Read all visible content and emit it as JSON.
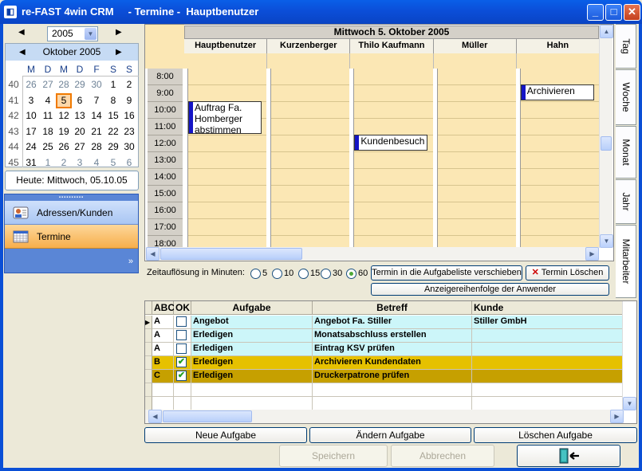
{
  "window": {
    "title": "re-FAST 4win CRM     - Termine -  Hauptbenutzer",
    "icon": "app-logo-icon",
    "controls": {
      "minimize": "_",
      "maximize": "□",
      "close": "✕"
    }
  },
  "year_selector": {
    "year": "2005",
    "prev": "◀",
    "next": "▶"
  },
  "calendar": {
    "month_label": "Oktober 2005",
    "weekdays": [
      "M",
      "D",
      "M",
      "D",
      "F",
      "S",
      "S"
    ],
    "weeks": [
      {
        "kw": "40",
        "days": [
          "26",
          "27",
          "28",
          "29",
          "30",
          "1",
          "2"
        ],
        "other": [
          0,
          1,
          2,
          3,
          4
        ]
      },
      {
        "kw": "41",
        "days": [
          "3",
          "4",
          "5",
          "6",
          "7",
          "8",
          "9"
        ],
        "other": []
      },
      {
        "kw": "42",
        "days": [
          "10",
          "11",
          "12",
          "13",
          "14",
          "15",
          "16"
        ],
        "other": []
      },
      {
        "kw": "43",
        "days": [
          "17",
          "18",
          "19",
          "20",
          "21",
          "22",
          "23"
        ],
        "other": []
      },
      {
        "kw": "44",
        "days": [
          "24",
          "25",
          "26",
          "27",
          "28",
          "29",
          "30"
        ],
        "other": []
      },
      {
        "kw": "45",
        "days": [
          "31",
          "1",
          "2",
          "3",
          "4",
          "5",
          "6"
        ],
        "other": [
          1,
          2,
          3,
          4,
          5,
          6
        ]
      }
    ],
    "selected_day": "5"
  },
  "today_label": "Heute: Mittwoch, 05.10.05",
  "nav": {
    "items": [
      {
        "label": "Adressen/Kunden",
        "icon": "contact-card-icon"
      },
      {
        "label": "Termine",
        "icon": "calendar-grid-icon"
      }
    ],
    "more": "»"
  },
  "scheduler": {
    "date_header": "Mittwoch 5. Oktober 2005",
    "resources": [
      "Hauptbenutzer",
      "Kurzenberger",
      "Thilo Kaufmann",
      "Müller",
      "Hahn"
    ],
    "times": [
      "8:00",
      "9:00",
      "10:00",
      "11:00",
      "12:00",
      "13:00",
      "14:00",
      "15:00",
      "16:00",
      "17:00",
      "18:00"
    ],
    "appointments": [
      {
        "resource": 0,
        "text": "Auftrag Fa. Homberger abstimmen"
      },
      {
        "resource": 4,
        "text": "Archivieren"
      },
      {
        "resource": 2,
        "text": "Kundenbesuch"
      }
    ]
  },
  "view_tabs": [
    "Tag",
    "Woche",
    "Monat",
    "Jahr",
    "Mitarbeiter"
  ],
  "resolution": {
    "label": "Zeitauflösung in Minuten:",
    "options": [
      "5",
      "10",
      "15",
      "30",
      "60"
    ],
    "selected": "60"
  },
  "actions": {
    "move_to_tasks": "Termin in die Aufgabeliste verschieben",
    "delete_appt": "Termin  Löschen",
    "user_order": "Anzeigereihenfolge der Anwender"
  },
  "tasks": {
    "columns": [
      "ABC",
      "OK",
      "Aufgabe",
      "Betreff",
      "Kunde"
    ],
    "rows": [
      {
        "abc": "A",
        "ok": false,
        "aufgabe": "Angebot",
        "betreff": "Angebot Fa. Stiller",
        "kunde": "Stiller GmbH",
        "color": "#ccf6f9"
      },
      {
        "abc": "A",
        "ok": false,
        "aufgabe": "Erledigen",
        "betreff": "Monatsabschluss erstellen",
        "kunde": "",
        "color": "#ccf6f9"
      },
      {
        "abc": "A",
        "ok": false,
        "aufgabe": "Erledigen",
        "betreff": "Eintrag KSV prüfen",
        "kunde": "",
        "color": "#ccf6f9"
      },
      {
        "abc": "B",
        "ok": true,
        "aufgabe": "Erledigen",
        "betreff": "Archivieren Kundendaten",
        "kunde": "",
        "color": "#e6c100"
      },
      {
        "abc": "C",
        "ok": true,
        "aufgabe": "Erledigen",
        "betreff": "Druckerpatrone prüfen",
        "kunde": "",
        "color": "#c6a000"
      }
    ]
  },
  "task_buttons": {
    "new": "Neue Aufgabe",
    "edit": "Ändern Aufgabe",
    "delete": "Löschen Aufgabe"
  },
  "footer_buttons": {
    "save": "Speichern",
    "cancel": "Abbrechen"
  },
  "colors": {
    "accent_blue": "#0a4fd6",
    "slot_yellow": "#fbe7b4",
    "appt_bar": "#1515c6"
  }
}
